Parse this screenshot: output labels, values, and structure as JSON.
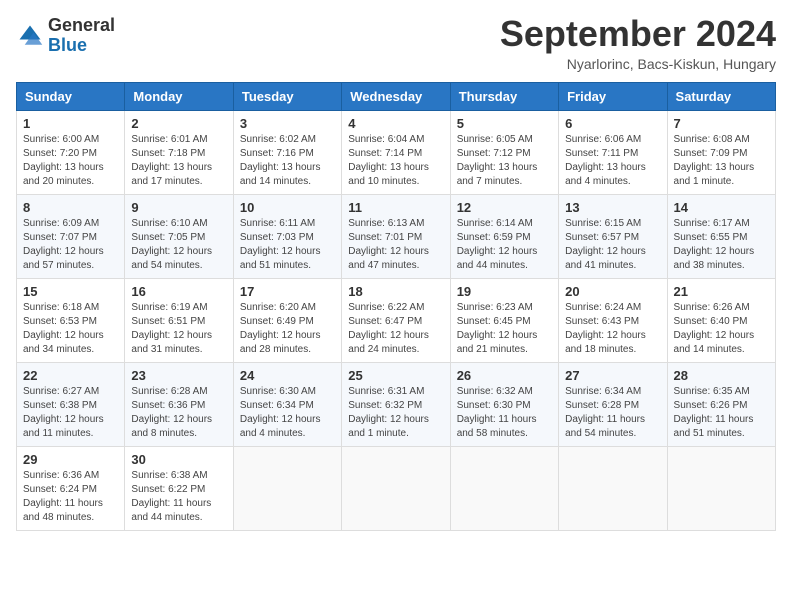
{
  "header": {
    "logo_general": "General",
    "logo_blue": "Blue",
    "month_title": "September 2024",
    "subtitle": "Nyarlorinc, Bacs-Kiskun, Hungary"
  },
  "weekdays": [
    "Sunday",
    "Monday",
    "Tuesday",
    "Wednesday",
    "Thursday",
    "Friday",
    "Saturday"
  ],
  "weeks": [
    [
      {
        "day": "1",
        "sunrise": "6:00 AM",
        "sunset": "7:20 PM",
        "daylight": "13 hours and 20 minutes."
      },
      {
        "day": "2",
        "sunrise": "6:01 AM",
        "sunset": "7:18 PM",
        "daylight": "13 hours and 17 minutes."
      },
      {
        "day": "3",
        "sunrise": "6:02 AM",
        "sunset": "7:16 PM",
        "daylight": "13 hours and 14 minutes."
      },
      {
        "day": "4",
        "sunrise": "6:04 AM",
        "sunset": "7:14 PM",
        "daylight": "13 hours and 10 minutes."
      },
      {
        "day": "5",
        "sunrise": "6:05 AM",
        "sunset": "7:12 PM",
        "daylight": "13 hours and 7 minutes."
      },
      {
        "day": "6",
        "sunrise": "6:06 AM",
        "sunset": "7:11 PM",
        "daylight": "13 hours and 4 minutes."
      },
      {
        "day": "7",
        "sunrise": "6:08 AM",
        "sunset": "7:09 PM",
        "daylight": "13 hours and 1 minute."
      }
    ],
    [
      {
        "day": "8",
        "sunrise": "6:09 AM",
        "sunset": "7:07 PM",
        "daylight": "12 hours and 57 minutes."
      },
      {
        "day": "9",
        "sunrise": "6:10 AM",
        "sunset": "7:05 PM",
        "daylight": "12 hours and 54 minutes."
      },
      {
        "day": "10",
        "sunrise": "6:11 AM",
        "sunset": "7:03 PM",
        "daylight": "12 hours and 51 minutes."
      },
      {
        "day": "11",
        "sunrise": "6:13 AM",
        "sunset": "7:01 PM",
        "daylight": "12 hours and 47 minutes."
      },
      {
        "day": "12",
        "sunrise": "6:14 AM",
        "sunset": "6:59 PM",
        "daylight": "12 hours and 44 minutes."
      },
      {
        "day": "13",
        "sunrise": "6:15 AM",
        "sunset": "6:57 PM",
        "daylight": "12 hours and 41 minutes."
      },
      {
        "day": "14",
        "sunrise": "6:17 AM",
        "sunset": "6:55 PM",
        "daylight": "12 hours and 38 minutes."
      }
    ],
    [
      {
        "day": "15",
        "sunrise": "6:18 AM",
        "sunset": "6:53 PM",
        "daylight": "12 hours and 34 minutes."
      },
      {
        "day": "16",
        "sunrise": "6:19 AM",
        "sunset": "6:51 PM",
        "daylight": "12 hours and 31 minutes."
      },
      {
        "day": "17",
        "sunrise": "6:20 AM",
        "sunset": "6:49 PM",
        "daylight": "12 hours and 28 minutes."
      },
      {
        "day": "18",
        "sunrise": "6:22 AM",
        "sunset": "6:47 PM",
        "daylight": "12 hours and 24 minutes."
      },
      {
        "day": "19",
        "sunrise": "6:23 AM",
        "sunset": "6:45 PM",
        "daylight": "12 hours and 21 minutes."
      },
      {
        "day": "20",
        "sunrise": "6:24 AM",
        "sunset": "6:43 PM",
        "daylight": "12 hours and 18 minutes."
      },
      {
        "day": "21",
        "sunrise": "6:26 AM",
        "sunset": "6:40 PM",
        "daylight": "12 hours and 14 minutes."
      }
    ],
    [
      {
        "day": "22",
        "sunrise": "6:27 AM",
        "sunset": "6:38 PM",
        "daylight": "12 hours and 11 minutes."
      },
      {
        "day": "23",
        "sunrise": "6:28 AM",
        "sunset": "6:36 PM",
        "daylight": "12 hours and 8 minutes."
      },
      {
        "day": "24",
        "sunrise": "6:30 AM",
        "sunset": "6:34 PM",
        "daylight": "12 hours and 4 minutes."
      },
      {
        "day": "25",
        "sunrise": "6:31 AM",
        "sunset": "6:32 PM",
        "daylight": "12 hours and 1 minute."
      },
      {
        "day": "26",
        "sunrise": "6:32 AM",
        "sunset": "6:30 PM",
        "daylight": "11 hours and 58 minutes."
      },
      {
        "day": "27",
        "sunrise": "6:34 AM",
        "sunset": "6:28 PM",
        "daylight": "11 hours and 54 minutes."
      },
      {
        "day": "28",
        "sunrise": "6:35 AM",
        "sunset": "6:26 PM",
        "daylight": "11 hours and 51 minutes."
      }
    ],
    [
      {
        "day": "29",
        "sunrise": "6:36 AM",
        "sunset": "6:24 PM",
        "daylight": "11 hours and 48 minutes."
      },
      {
        "day": "30",
        "sunrise": "6:38 AM",
        "sunset": "6:22 PM",
        "daylight": "11 hours and 44 minutes."
      },
      null,
      null,
      null,
      null,
      null
    ]
  ]
}
